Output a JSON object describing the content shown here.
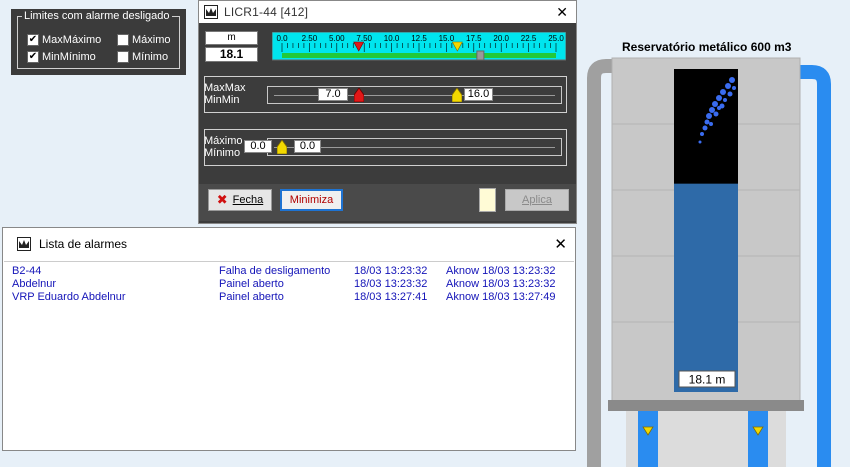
{
  "limits_panel": {
    "legend": "Limites com alarme desligado",
    "options": [
      {
        "label": "MaxMáximo",
        "checked": true
      },
      {
        "label": "Máximo",
        "checked": false
      },
      {
        "label": "MinMínimo",
        "checked": true
      },
      {
        "label": "Mínimo",
        "checked": false
      }
    ]
  },
  "main_window": {
    "title": "LICR1-44  [412]",
    "close_symbol": "✕",
    "unit": "m",
    "value": "18.1",
    "scale": {
      "min": 0.0,
      "max": 25.0,
      "ticks": [
        "0.0",
        "2.50",
        "5.00",
        "7.50",
        "10.0",
        "12.5",
        "15.0",
        "17.5",
        "20.0",
        "22.5",
        "25.0"
      ],
      "current": 18.1,
      "minmin": 7.0,
      "maxmax": 16.0,
      "minimo": 0.0,
      "maximo": 0.0
    },
    "maxmax_group": {
      "label_top": "MaxMax",
      "label_bottom": "MinMin",
      "min_value": "7.0",
      "max_value": "16.0"
    },
    "maximo_group": {
      "label_top": "Máximo",
      "label_bottom": "Mínimo",
      "min_value": "0.0",
      "max_value": "0.0"
    },
    "buttons": {
      "fecha_icon": "✖",
      "fecha": "Fecha",
      "minimiza": "Minimiza",
      "aplica": "Aplica"
    }
  },
  "alarm_window": {
    "title": "Lista de alarmes",
    "close_symbol": "✕",
    "rows": [
      {
        "tag": "B2-44",
        "message": "Falha de desligamento",
        "time": "18/03  13:23:32",
        "ack": "Aknow 18/03 13:23:32"
      },
      {
        "tag": "Abdelnur",
        "message": "Painel aberto",
        "time": "18/03  13:23:32",
        "ack": "Aknow 18/03 13:23:32"
      },
      {
        "tag": "VRP Eduardo Abdelnur",
        "message": "Painel aberto",
        "time": "18/03  13:27:41",
        "ack": "Aknow 18/03 13:27:49"
      }
    ]
  },
  "reservoir": {
    "title": "Reservatório metálico 600 m3",
    "level_label": "18.1  m",
    "level_fraction": 0.645
  },
  "colors": {
    "panel_dark": "#3c3c3c",
    "alarm_text": "#1414b8",
    "scale_bg": "#00e5ee",
    "scale_green": "#22c93a",
    "water": "#2e6aa8",
    "pipe_blue": "#2a8cf0",
    "marker_red": "#e01818",
    "marker_yellow": "#f2d800"
  }
}
